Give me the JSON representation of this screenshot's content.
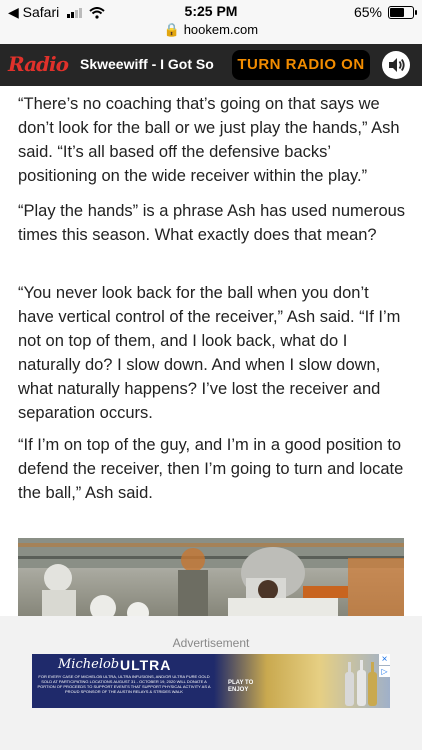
{
  "status_bar": {
    "back_app": "Safari",
    "time": "5:25 PM",
    "battery": "65%",
    "battery_level": 0.65,
    "url": "hookem.com"
  },
  "radio_bar": {
    "logo": "Radio",
    "now_playing": "Skweewiff - I Got So",
    "turn_on_label": "TURN RADIO ON"
  },
  "article": {
    "paragraphs": [
      "“There’s no coaching that’s going on that says we don’t look for the ball or we just play the hands,” Ash said. “It’s all based off the defensive backs’ positioning on the wide receiver within the play.”",
      "“Play the hands” is a phrase Ash has used numerous times this season. What exactly does that mean?",
      "“You never look back for the ball when you don’t have vertical control of the receiver,” Ash said. “If I’m not on top of them, and I look back, what do I naturally do? I slow down. And when I slow down, what naturally happens? I’ve lost the receiver and separation occurs.",
      "“If I’m on top of the guy, and I’m in a good position to defend the receiver, then I’m going to turn and locate the ball,” Ash said."
    ]
  },
  "ad": {
    "label": "Advertisement",
    "brand_script": "Michelob",
    "brand_name": "ULTRA",
    "cta": "PLAY TO ENJOY",
    "fine_print": "FOR EVERY CASE OF MICHELOB ULTRA, ULTRA INFUSIONS, AND/OR ULTRA PURE GOLD SOLD AT PARTICIPATING LOCATIONS AUGUST 31 - OCTOBER 19, 2020 WILL DONATE A PORTION OF PROCEEDS TO SUPPORT EVENTS THAT SUPPORT PHYSICAL ACTIVITY AS A PROUD SPONSOR OF THE AUSTIN RELAYS & STRIDES WALK"
  }
}
